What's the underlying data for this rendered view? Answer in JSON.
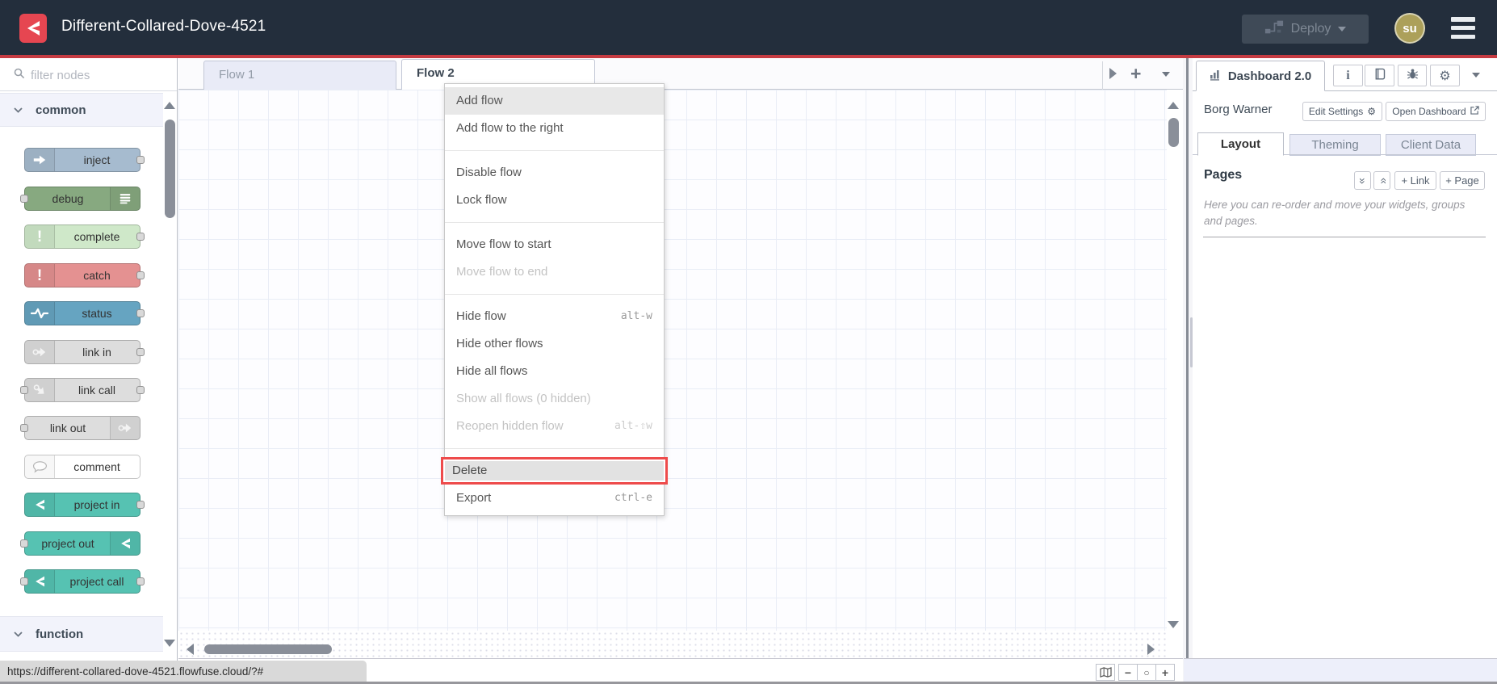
{
  "header": {
    "title": "Different-Collared-Dove-4521",
    "deploy_label": "Deploy",
    "avatar_initials": "su"
  },
  "colors": {
    "header_bg": "#232e3c",
    "accent_red_line": "#c63b42",
    "logo_red": "#e64651",
    "avatar_olive": "#aca05a",
    "delete_highlight_border": "#ee4b4b"
  },
  "palette": {
    "filter_placeholder": "filter nodes",
    "categories": [
      {
        "label": "common"
      },
      {
        "label": "function"
      }
    ],
    "nodes": [
      {
        "label": "inject",
        "color": "#a6bbcf"
      },
      {
        "label": "debug",
        "color": "#87a980"
      },
      {
        "label": "complete",
        "color": "#cfe8c9"
      },
      {
        "label": "catch",
        "color": "#e49191"
      },
      {
        "label": "status",
        "color": "#66a4c1"
      },
      {
        "label": "link in",
        "color": "#dddddd"
      },
      {
        "label": "link call",
        "color": "#dddddd"
      },
      {
        "label": "link out",
        "color": "#dddddd"
      },
      {
        "label": "comment",
        "color": "#ffffff"
      },
      {
        "label": "project in",
        "color": "#56c2b2"
      },
      {
        "label": "project out",
        "color": "#56c2b2"
      },
      {
        "label": "project call",
        "color": "#56c2b2"
      }
    ]
  },
  "workspace": {
    "tabs": [
      {
        "label": "Flow 1",
        "active": false
      },
      {
        "label": "Flow 2",
        "active": true
      }
    ]
  },
  "context_menu": {
    "items": [
      {
        "label": "Add flow",
        "state": "hover"
      },
      {
        "label": "Add flow to the right"
      },
      {
        "divider": true
      },
      {
        "label": "Disable flow"
      },
      {
        "label": "Lock flow"
      },
      {
        "divider": true
      },
      {
        "label": "Move flow to start"
      },
      {
        "label": "Move flow to end",
        "disabled": true
      },
      {
        "divider": true
      },
      {
        "label": "Hide flow",
        "shortcut": "alt-w"
      },
      {
        "label": "Hide other flows"
      },
      {
        "label": "Hide all flows"
      },
      {
        "label": "Show all flows (0 hidden)",
        "disabled": true
      },
      {
        "label": "Reopen hidden flow",
        "shortcut": "alt-⇧w",
        "disabled": true
      },
      {
        "divider": true
      },
      {
        "label": "Delete",
        "state": "target"
      },
      {
        "label": "Export",
        "shortcut": "ctrl-e"
      }
    ]
  },
  "sidebar": {
    "tab_label": "Dashboard 2.0",
    "instance_name": "Borg Warner",
    "edit_settings_label": "Edit Settings",
    "open_dashboard_label": "Open Dashboard",
    "tabs": [
      {
        "label": "Layout",
        "active": true
      },
      {
        "label": "Theming",
        "active": false
      },
      {
        "label": "Client Data",
        "active": false
      }
    ],
    "pages": {
      "title": "Pages",
      "add_link_label": "+ Link",
      "add_page_label": "+ Page",
      "help_text": "Here you can re-order and move your widgets, groups and pages."
    }
  },
  "statusbar": {
    "url": "https://different-collared-dove-4521.flowfuse.cloud/?#"
  }
}
